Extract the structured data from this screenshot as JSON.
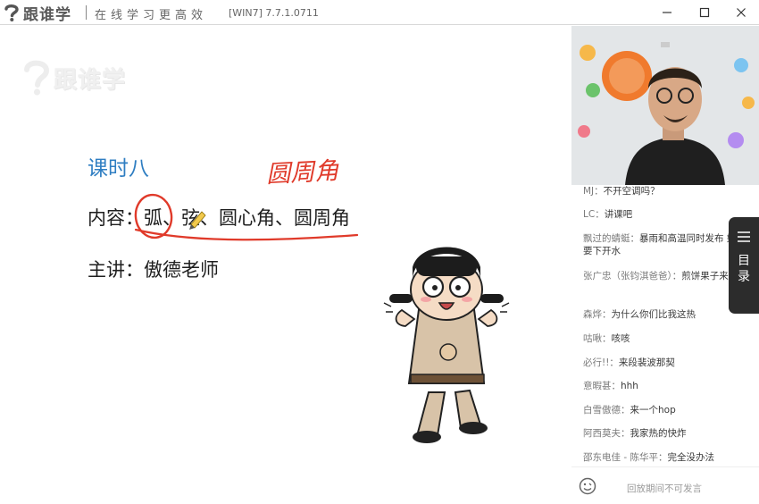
{
  "titlebar": {
    "logo_text": "跟谁学",
    "slogan": "在线学习更高效",
    "version": "[WIN7] 7.7.1.0711"
  },
  "slide": {
    "watermark": "跟谁学",
    "lesson_title": "课时八",
    "annotation": "圆周角",
    "content_line": "内容：弧、弦、圆心角、圆周角",
    "teacher_line": "主讲：傲德老师"
  },
  "chat": {
    "messages": [
      {
        "user": "MJ",
        "text": "不开空调吗？"
      },
      {
        "user": "LC",
        "text": "讲课吧"
      },
      {
        "user": "飘过的蜻蜓",
        "text": "暴雨和高温同时发布 好像要下开水"
      },
      {
        "user": "张广忠（张钧淇爸爸）",
        "text": "煎饼果子来一套"
      },
      {
        "user": "森烨",
        "text": "为什么你们比我这热"
      },
      {
        "user": "咕啾",
        "text": "咳咳"
      },
      {
        "user": "必行!!",
        "text": "来段裴波那契"
      },
      {
        "user": "意暇甚",
        "text": "hhh"
      },
      {
        "user": "白雪傲德",
        "text": "来一个hop"
      },
      {
        "user": "阿西莫夫",
        "text": "我家热的快炸"
      },
      {
        "user": "邵东电佳 - 陈华平",
        "text": "完全没办法"
      }
    ],
    "input_placeholder": "回放期间不可发言"
  },
  "sidetab": {
    "label_1": "目",
    "label_2": "录"
  },
  "colors": {
    "accent_blue": "#2f7ec2",
    "ink_red": "#e03a2a",
    "brand_orange": "#f07a2d"
  }
}
